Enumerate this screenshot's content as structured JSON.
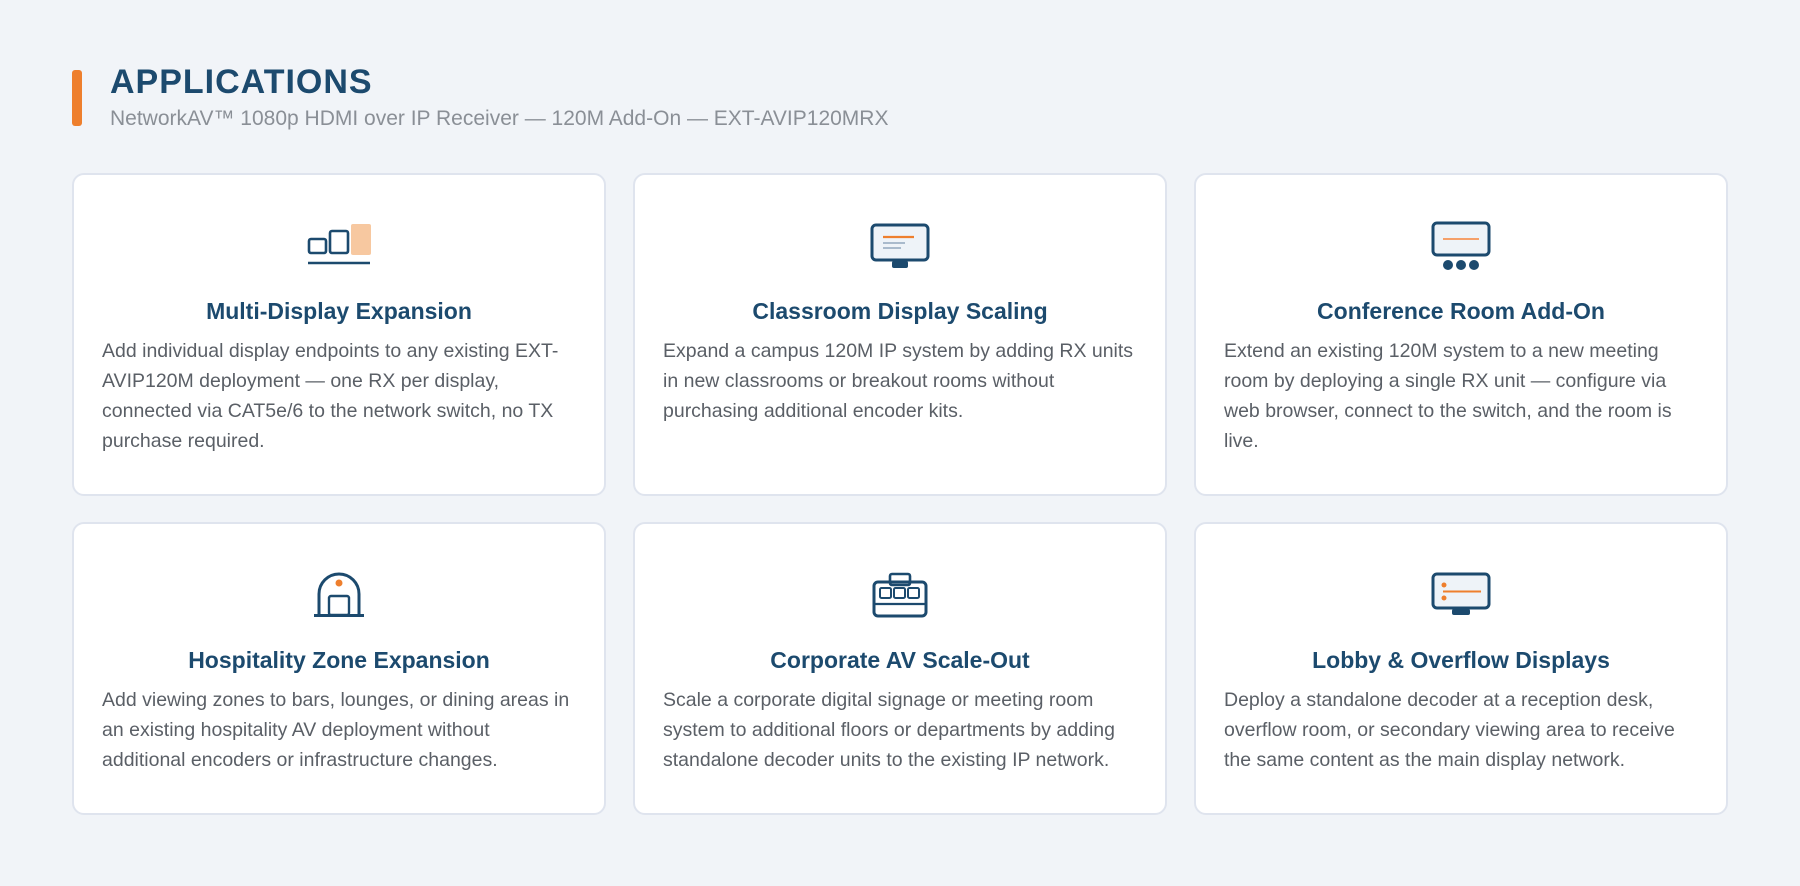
{
  "header": {
    "title": "APPLICATIONS",
    "subtitle": "NetworkAV™ 1080p HDMI over IP Receiver — 120M Add-On — EXT-AVIP120MRX"
  },
  "colors": {
    "accent": "#ee7f2d",
    "navy": "#1c4a6e",
    "background": "#f1f4f8",
    "card_border": "#dfe4ee"
  },
  "cards": [
    {
      "icon": "multi-display-icon",
      "title": "Multi-Display Expansion",
      "description": "Add individual display endpoints to any existing EXT-AVIP120M deployment — one RX per display, connected via CAT5e/6 to the network switch, no TX purchase required."
    },
    {
      "icon": "classroom-monitor-icon",
      "title": "Classroom Display Scaling",
      "description": "Expand a campus 120M IP system by adding RX units in new classrooms or breakout rooms without purchasing additional encoder kits."
    },
    {
      "icon": "conference-room-icon",
      "title": "Conference Room Add-On",
      "description": "Extend an existing 120M system to a new meeting room by deploying a single RX unit — configure via web browser, connect to the switch, and the room is live."
    },
    {
      "icon": "hospitality-arch-icon",
      "title": "Hospitality Zone Expansion",
      "description": "Add viewing zones to bars, lounges, or dining areas in an existing hospitality AV deployment without additional encoders or infrastructure changes."
    },
    {
      "icon": "corporate-briefcase-icon",
      "title": "Corporate AV Scale-Out",
      "description": "Scale a corporate digital signage or meeting room system to additional floors or departments by adding standalone decoder units to the existing IP network."
    },
    {
      "icon": "lobby-display-icon",
      "title": "Lobby & Overflow Displays",
      "description": "Deploy a standalone decoder at a reception desk, overflow room, or secondary viewing area to receive the same content as the main display network."
    }
  ]
}
